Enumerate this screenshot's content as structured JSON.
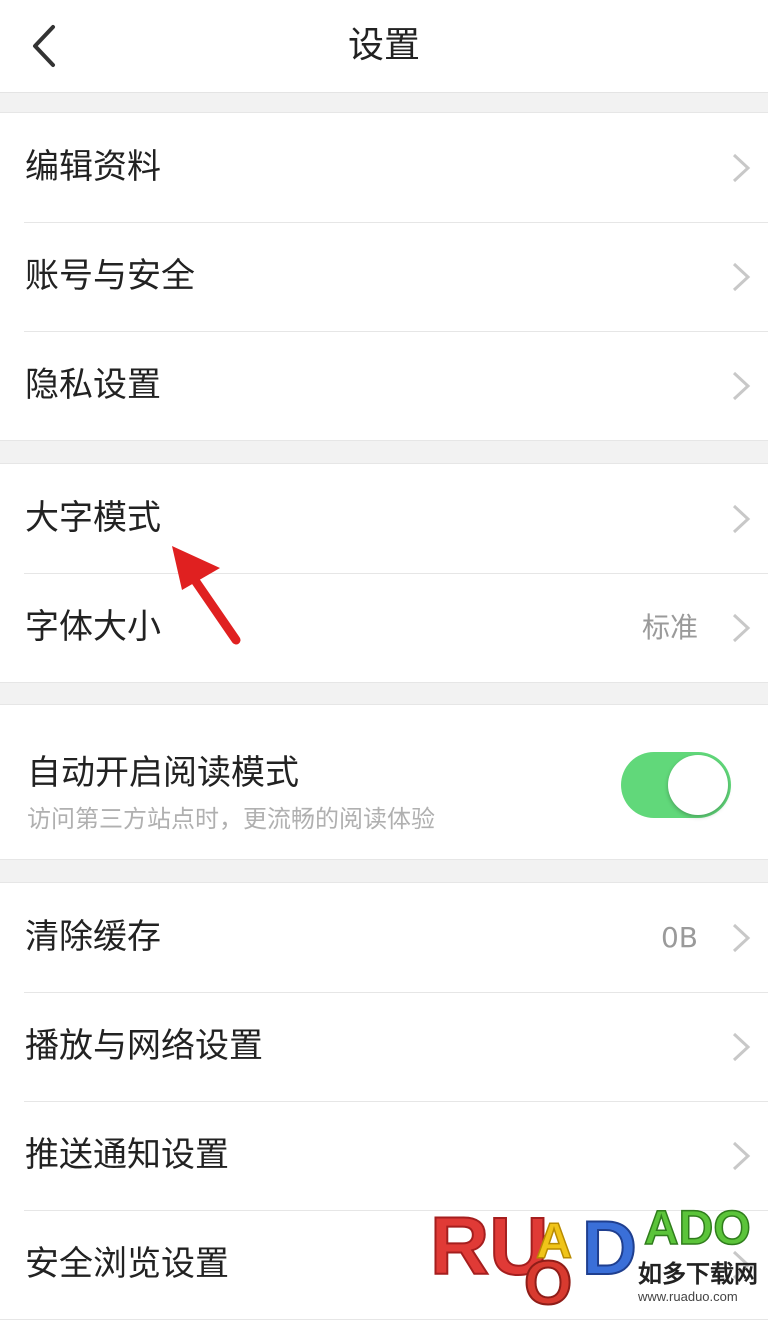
{
  "header": {
    "title": "设置"
  },
  "groups": {
    "profile": [
      {
        "label": "编辑资料"
      },
      {
        "label": "账号与安全"
      },
      {
        "label": "隐私设置"
      }
    ],
    "display": [
      {
        "label": "大字模式"
      },
      {
        "label": "字体大小",
        "value": "标准"
      }
    ],
    "reading": {
      "label": "自动开启阅读模式",
      "description": "访问第三方站点时，更流畅的阅读体验",
      "enabled": true
    },
    "misc": [
      {
        "label": "清除缓存",
        "value": "0B"
      },
      {
        "label": "播放与网络设置"
      },
      {
        "label": "推送通知设置"
      },
      {
        "label": "安全浏览设置"
      }
    ]
  },
  "watermark": {
    "brand": "RUADADO",
    "cn": "如多下载网",
    "url": "www.ruaduo.com"
  },
  "colors": {
    "toggle_on": "#61d87a",
    "arrow": "#e02020"
  }
}
